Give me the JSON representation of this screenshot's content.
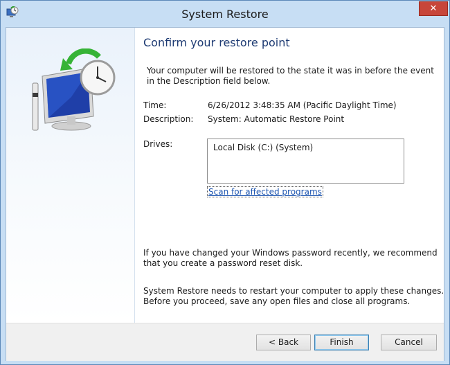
{
  "window": {
    "title": "System Restore",
    "close_label": "✕"
  },
  "page": {
    "heading": "Confirm your restore point",
    "intro_line1": "Your computer will be restored to the state it was in before the event",
    "intro_line2": "in the Description field below.",
    "time_label": "Time:",
    "time_value": "6/26/2012 3:48:35 AM (Pacific Daylight Time)",
    "description_label": "Description:",
    "description_value": "System: Automatic Restore Point",
    "drives_label": "Drives:",
    "drives": [
      "Local Disk (C:) (System)"
    ],
    "scan_link": "Scan for affected programs",
    "password_note_line1": "If you have changed your Windows password recently, we recommend",
    "password_note_line2": "that you create a password reset disk.",
    "restart_note_line1": "System Restore needs to restart your computer to apply these changes.",
    "restart_note_line2": "Before you proceed, save any open files and close all programs."
  },
  "footer": {
    "back_label": "< Back",
    "finish_label": "Finish",
    "cancel_label": "Cancel"
  },
  "icons": {
    "app": "system-restore-icon",
    "illustration": "computer-restore-clock-icon",
    "close": "close-icon"
  },
  "colors": {
    "heading": "#1e3b73",
    "link": "#1d55b0",
    "close_button": "#c7463a",
    "frame": "#c7def4"
  }
}
